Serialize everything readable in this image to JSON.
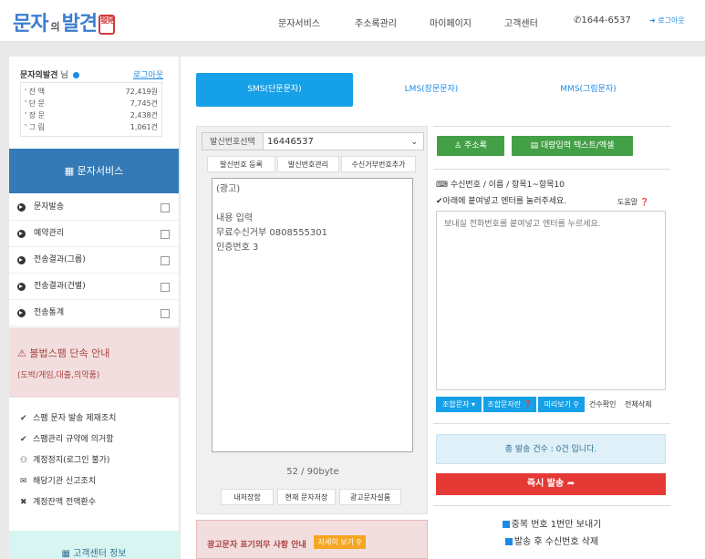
{
  "header": {
    "logo": "문자",
    "logo_small": "의",
    "logo_end": "발견",
    "logo_seal": "發見",
    "nav": [
      {
        "label": "문자서비스"
      },
      {
        "label": "주소록관리"
      },
      {
        "label": "마이페이지"
      },
      {
        "label": "고객센터"
      }
    ],
    "phone": "1644-6537",
    "login": "로그아웃"
  },
  "sidebar": {
    "user": "문자의발견",
    "user_suffix": "님",
    "logout": "로그아웃",
    "balances": [
      {
        "label": "' 잔  액",
        "value": "72,419원"
      },
      {
        "label": "' 단  문",
        "value": "7,745건"
      },
      {
        "label": "' 장  문",
        "value": "2,438건"
      },
      {
        "label": "' 그  림",
        "value": "1,061건"
      }
    ],
    "service_header": "문자서비스",
    "service_items": [
      {
        "label": "문자발송"
      },
      {
        "label": "예약관리"
      },
      {
        "label": "전송결과(그룹)"
      },
      {
        "label": "전송결과(건별)"
      },
      {
        "label": "전송통계"
      }
    ],
    "spam_title": "불법스팸 단속 안내",
    "spam_sub": "(도박/게임,대출,의약품)",
    "spam_items": [
      {
        "label": "스팸 문자 발송 제재조치"
      },
      {
        "label": "스팸관리 규약에 의거함"
      },
      {
        "label": "계정정지(로그인 불가)"
      },
      {
        "label": "해당기관 신고조치"
      },
      {
        "label": "계정잔액 전액환수"
      }
    ],
    "support": "고객센터 정보"
  },
  "tabs": [
    {
      "label": "SMS(단문문자)"
    },
    {
      "label": "LMS(장문문자)"
    },
    {
      "label": "MMS(그림문자)"
    }
  ],
  "editor": {
    "sender_label": "발신번호선택",
    "sender_value": "16446537",
    "btn_register": "발신번호 등록",
    "btn_manage": "발신번호관리",
    "btn_reject": "수신거부번호추가",
    "message": "(광고)\n\n내용 입력\n무료수신거부 0808555301\n인증번호 3",
    "byte_count": "52 / 90byte",
    "btn_my": "내저장함",
    "btn_save": "현재 문자저장",
    "btn_ad": "광고문자설룸"
  },
  "recipients": {
    "btn_address": "주소록",
    "btn_bulk": "대량입력 텍스트/엑셀",
    "header": "수신번호 / 이름 / 항목1~항목10",
    "hint": "아래에 붙여넣고 엔터를 눌러주세요.",
    "help": "도움말",
    "placeholder": "보내실 전화번호를 붙여넣고 엔터를 누르세요.",
    "btn_merge": "조합문자",
    "btn_merge_help": "조합문자란",
    "btn_preview": "미리보기",
    "count_check": "건수확인",
    "delete_all": "전체삭제",
    "total": "총 발송 건수 : 0건 입니다.",
    "send": "즉시 발송",
    "opt_dedupe": "중복 번호 1번만 보내기",
    "opt_delete": "발송 후 수신번호 삭제"
  },
  "ad_notice": {
    "title": "광고문자 표기의무 사항 안내",
    "btn": "자세히 보기"
  }
}
